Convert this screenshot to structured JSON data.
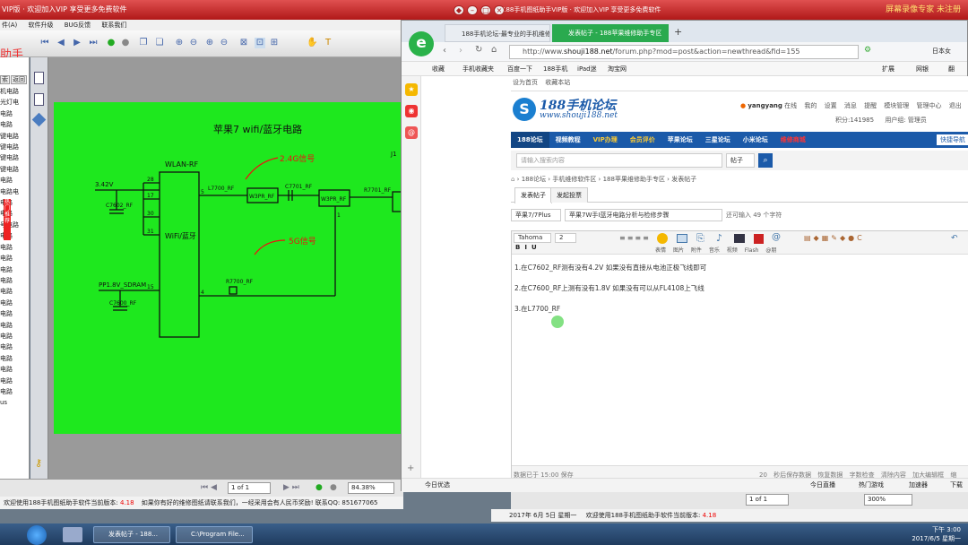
{
  "bg_app": {
    "title": "VIP版 · 欢迎加入VIP 享受更多免费软件",
    "title_right": "屏幕录像专家 未注册",
    "right_title": "188手机图纸助手VIP版 · 欢迎加入VIP 享受更多免费软件",
    "menu": [
      "件(A)",
      "软件升级",
      "BUG反馈",
      "联系我们"
    ],
    "logo_fragment": "助手",
    "panel_tabs": [
      "索",
      "返回"
    ],
    "list_items": [
      "机电路",
      "光灯电",
      "电路",
      "电路",
      "键电路",
      "键电路",
      "键电路",
      "键电路",
      "电路",
      "电路电",
      "电路",
      "电路",
      "号电路",
      "电路",
      "电路",
      "电路",
      "电路",
      "电路",
      "电路",
      "电路",
      "电路",
      "电路",
      "电路",
      "电路",
      "电路",
      "电路",
      "电路",
      "电路",
      "us"
    ],
    "schematic": {
      "title": "苹果7 wifi/蓝牙电路",
      "chip": "WLAN-RF",
      "chip_inner": "WiFi/蓝牙",
      "note_24g": "2.4G信号",
      "note_5g": "5G信号",
      "label_v42": "3.42V",
      "label_pp18": "PP1.8V_SDRAM",
      "labels": [
        "C7602_RF",
        "C7600_RF",
        "L7700_RF",
        "W3PR_RF",
        "C7701_RF",
        "W3PR_RF",
        "R7700_RF",
        "R7701_RF",
        "J1"
      ],
      "pins": [
        "28",
        "17",
        "30",
        "31",
        "15",
        "5",
        "4",
        "1"
      ]
    },
    "page_input": "1 of 1",
    "zoom": "84.38%",
    "zoom_right": "300%",
    "status": {
      "prefix": "欢迎使用188手机图纸助手软件当前版本:",
      "version": "4.18",
      "msg": "如果你有好的维修图纸请联系我们，一经采用会有人民币奖励! 联系QQ: 851677065",
      "date": "2017年 6月 5日 星期一"
    }
  },
  "browser": {
    "tabs": [
      {
        "label": "188手机论坛-最专业的手机维修"
      },
      {
        "label": "发表帖子 - 188苹果维修助手专区"
      }
    ],
    "url_prefix": "http://www.",
    "url_domain": "shouji188.net",
    "url_path": "/forum.php?mod=post&action=newthread&fid=155",
    "addr_right": "日本女",
    "bookmarks": [
      "收藏",
      "手机收藏夹",
      "百度一下",
      "188手机",
      "iPad迷",
      "淘宝网"
    ],
    "book_right": [
      "扩展",
      "网银",
      "翻"
    ],
    "top_links": [
      "设为首页",
      "收藏本站"
    ],
    "footer": "今日优选",
    "footer_right": [
      "今日直播",
      "热门游戏",
      "加速器",
      "下载"
    ]
  },
  "forum": {
    "logo_title": "188手机论坛",
    "logo_url": "www.shouji188.net",
    "user": {
      "name": "yangyang",
      "online": "在线",
      "menus": [
        "我的",
        "设置",
        "消息",
        "提醒",
        "模块管理",
        "管理中心",
        "退出"
      ],
      "points_label": "积分:",
      "points": "141985",
      "group": "用户组: 管理员"
    },
    "nav": [
      "188论坛",
      "视频教程",
      "VIP办理",
      "会员评价",
      "苹果论坛",
      "三星论坛",
      "小米论坛",
      "维修商城"
    ],
    "nav_right": "快捷导航",
    "search_placeholder": "请输入搜索内容",
    "search_type": "帖子",
    "breadcrumb": [
      "188论坛",
      "手机维修软件区",
      "188苹果维修助手专区",
      "发表帖子"
    ],
    "tabs": [
      "发表帖子",
      "发起投票"
    ],
    "category": "苹果7/7Plus",
    "subject": "苹果7W手I蓝牙电路分析与检修步骤",
    "char_hint": "还可输入 49 个字符",
    "font": "Tahoma",
    "size": "2",
    "toolbar_labels": [
      "表情",
      "图片",
      "附件",
      "音乐",
      "视频",
      "Flash",
      "@朋"
    ],
    "body": [
      "1.在C7602_RF测有没有4.2V 如果没有直接从电池正极飞线即可",
      "2.在C7600_RF上测有没有1.8V 如果没有可以从FL4108上飞线",
      "3.在L7700_RF"
    ],
    "status_left": "数据已于 15:00 保存",
    "status_right": [
      "20 秒后保存数据",
      "恢复数据",
      "字数检查",
      "清除内容",
      "加大编辑框",
      "缩"
    ]
  },
  "taskbar": {
    "items": [
      "发表帖子 - 188...",
      "C:\\Program File..."
    ],
    "time": "下午 3:00",
    "date": "2017/6/5 星期一"
  }
}
